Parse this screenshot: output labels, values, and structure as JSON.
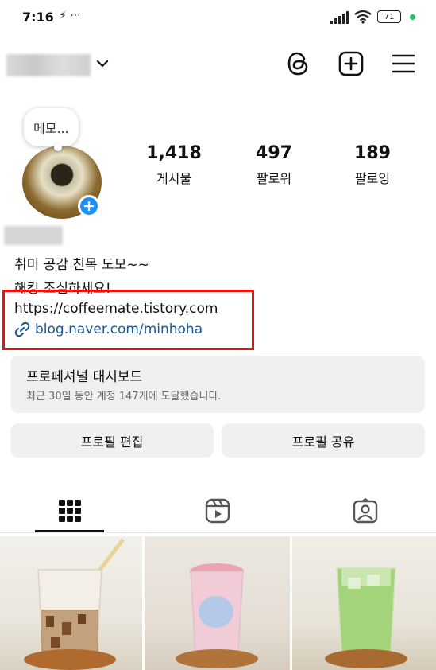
{
  "status_bar": {
    "time": "7:16",
    "extra": "⚡ ···",
    "battery": "71"
  },
  "header": {
    "username": ""
  },
  "profile": {
    "memo": "메모...",
    "stats": [
      {
        "value": "1,418",
        "label": "게시물"
      },
      {
        "value": "497",
        "label": "팔로워"
      },
      {
        "value": "189",
        "label": "팔로잉"
      }
    ],
    "bio_lines": [
      "취미 공감 친목 도모~~",
      "해킹 조심하세요!"
    ],
    "link_1": "https://coffeemate.tistory.com",
    "link_2": "blog.naver.com/minhoha"
  },
  "dashboard": {
    "title": "프로페셔널 대시보드",
    "subtitle": "최근 30일 동안 계정 147개에 도달했습니다."
  },
  "buttons": {
    "edit": "프로필 편집",
    "share": "프로필 공유"
  },
  "tabs": [
    {
      "icon": "grid-icon",
      "active": true
    },
    {
      "icon": "reels-icon",
      "active": false
    },
    {
      "icon": "tagged-icon",
      "active": false
    }
  ],
  "posts": [
    {
      "kind": "photo",
      "subject": "iced coffee with jelly"
    },
    {
      "kind": "photo",
      "subject": "pink frappe"
    },
    {
      "kind": "photo",
      "subject": "green iced drink"
    }
  ]
}
